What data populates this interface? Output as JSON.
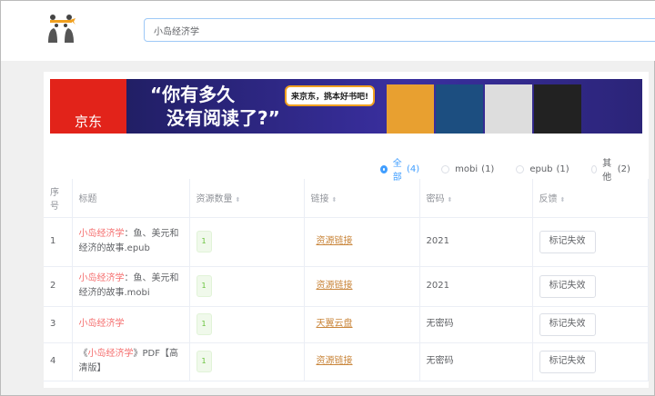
{
  "search": {
    "value": "小岛经济学"
  },
  "banner": {
    "brand": "京东",
    "slogan_line1": "“你有多久",
    "slogan_line2": "没有阅读了?”",
    "bubble": "来京东，挑本好书吧!"
  },
  "filters": [
    {
      "label": "全部",
      "count": "(4)",
      "selected": true
    },
    {
      "label": "mobi",
      "count": "(1)",
      "selected": false
    },
    {
      "label": "epub",
      "count": "(1)",
      "selected": false
    },
    {
      "label": "其他",
      "count": "(2)",
      "selected": false
    }
  ],
  "table": {
    "headers": [
      "序号",
      "标题",
      "资源数量",
      "链接",
      "密码",
      "反馈"
    ],
    "rows": [
      {
        "no": "1",
        "pre": "",
        "hl": "小岛经济学",
        "post": "：鱼、美元和经济的故事.epub",
        "count": "1",
        "link": "资源链接",
        "pwd": "2021",
        "btn": "标记失效"
      },
      {
        "no": "2",
        "pre": "",
        "hl": "小岛经济学",
        "post": "：鱼、美元和经济的故事.mobi",
        "count": "1",
        "link": "资源链接",
        "pwd": "2021",
        "btn": "标记失效"
      },
      {
        "no": "3",
        "pre": "",
        "hl": "小岛经济学",
        "post": "",
        "count": "1",
        "link": "天翼云盘",
        "pwd": "无密码",
        "btn": "标记失效"
      },
      {
        "no": "4",
        "pre": "《",
        "hl": "小岛经济学",
        "post": "》PDF【高清版】",
        "count": "1",
        "link": "资源链接",
        "pwd": "无密码",
        "btn": "标记失效"
      }
    ]
  }
}
